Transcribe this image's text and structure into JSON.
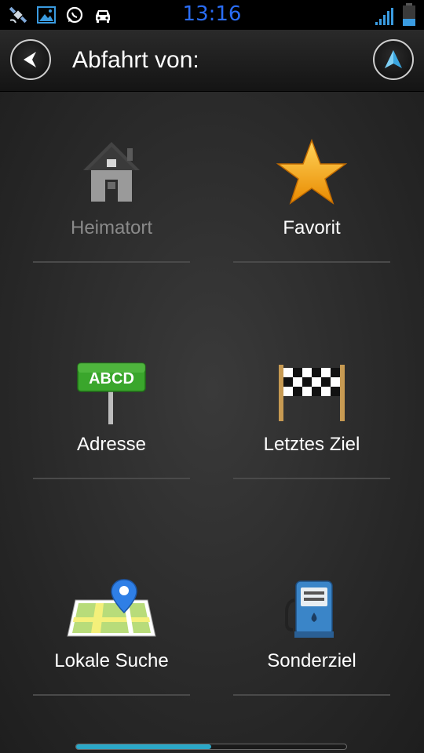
{
  "status_bar": {
    "time": "13:16",
    "icons": [
      "satellite-icon",
      "gallery-icon",
      "whatsapp-icon",
      "car-icon",
      "signal-icon",
      "battery-icon"
    ]
  },
  "header": {
    "title": "Abfahrt von:",
    "back_icon": "back-arrow-icon",
    "nav_icon": "navigation-arrow-icon"
  },
  "tiles": [
    {
      "label": "Heimatort",
      "icon": "home-icon",
      "enabled": false
    },
    {
      "label": "Favorit",
      "icon": "star-icon",
      "enabled": true
    },
    {
      "label": "Adresse",
      "icon": "address-sign-icon",
      "sign_text": "ABCD",
      "enabled": true
    },
    {
      "label": "Letztes Ziel",
      "icon": "finish-flag-icon",
      "enabled": true
    },
    {
      "label": "Lokale Suche",
      "icon": "map-pin-icon",
      "enabled": true
    },
    {
      "label": "Sonderziel",
      "icon": "fuel-pump-icon",
      "enabled": true
    }
  ],
  "scroll": {
    "position_fraction": 0.5
  },
  "colors": {
    "clock": "#2a6df5",
    "accent": "#2ba8c8",
    "star": "#f5a623",
    "sign_green": "#3aa62c"
  }
}
